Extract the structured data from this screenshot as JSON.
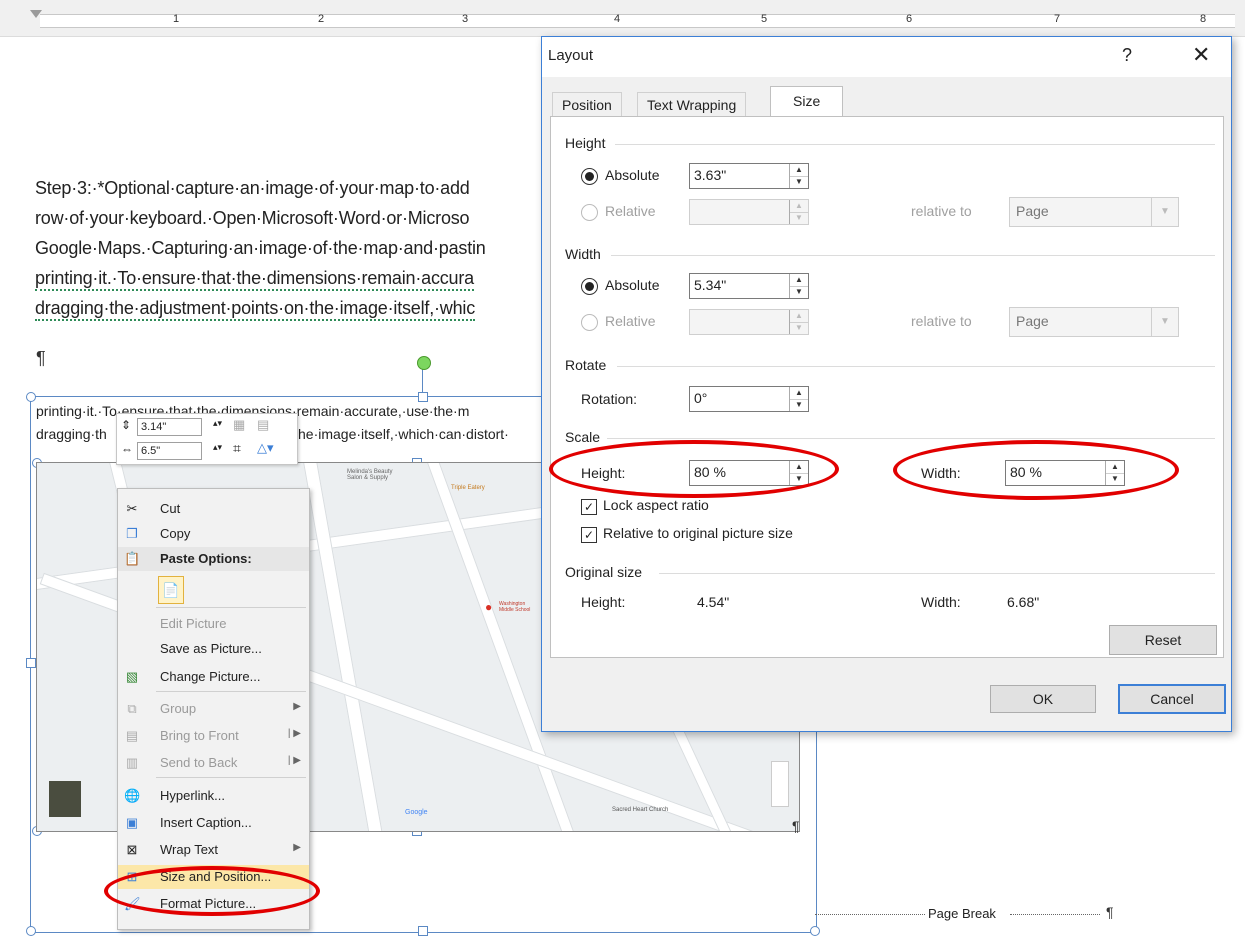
{
  "ruler": {
    "numbers": [
      "1",
      "2",
      "3",
      "4",
      "5",
      "6",
      "7",
      "8"
    ]
  },
  "document": {
    "lines": [
      "Step·3:·*Optional·capture·an·image·of·your·map·to·add",
      "row·of·your·keyboard.·Open·Microsoft·Word·or·Microso",
      "Google·Maps.·Capturing·an·image·of·the·map·and·pastin",
      "printing·it.·To·ensure·that·the·dimensions·remain·accura",
      "dragging·the·adjustment·points·on·the·image·itself,·whic"
    ],
    "pilcrow": "¶",
    "overlay_line1": "printing·it.·To·ensure·that·the·dimensions·remain·accurate,·use·the·m",
    "overlay_line2a": "dragging·th",
    "overlay_line2b": "he·image·itself,·which·can·distort·",
    "page_break": "Page Break"
  },
  "mini_toolbar": {
    "height_value": "3.14\"",
    "width_value": "6.5\""
  },
  "context_menu": {
    "cut": "Cut",
    "copy": "Copy",
    "paste_options": "Paste Options:",
    "edit_picture": "Edit Picture",
    "save_as_picture": "Save as Picture...",
    "change_picture": "Change Picture...",
    "group": "Group",
    "bring_to_front": "Bring to Front",
    "send_to_back": "Send to Back",
    "hyperlink": "Hyperlink...",
    "insert_caption": "Insert Caption...",
    "wrap_text": "Wrap Text",
    "size_and_position": "Size and Position...",
    "format_picture": "Format Picture..."
  },
  "map": {
    "labels": [
      "Melinda's Beauty Salon & Supply",
      "Washington Middle School",
      "Sacred Heart Church",
      "Google",
      "Triple Eatery"
    ]
  },
  "dialog": {
    "title": "Layout",
    "help": "?",
    "close": "✕",
    "tabs": [
      "Position",
      "Text Wrapping",
      "Size"
    ],
    "height_group": "Height",
    "width_group": "Width",
    "rotate_group": "Rotate",
    "scale_group": "Scale",
    "original_group": "Original size",
    "absolute": "Absolute",
    "relative": "Relative",
    "relative_to": "relative to",
    "page": "Page",
    "height_absolute_value": "3.63\"",
    "width_absolute_value": "5.34\"",
    "rotation_label": "Rotation:",
    "rotation_value": "0°",
    "scale_height_label": "Height:",
    "scale_height_value": "80 %",
    "scale_width_label": "Width:",
    "scale_width_value": "80 %",
    "lock_aspect": "Lock aspect ratio",
    "relative_original": "Relative to original picture size",
    "orig_height_label": "Height:",
    "orig_height_value": "4.54\"",
    "orig_width_label": "Width:",
    "orig_width_value": "6.68\"",
    "reset": "Reset",
    "ok": "OK",
    "cancel": "Cancel"
  },
  "annotation_color": "#e10000"
}
